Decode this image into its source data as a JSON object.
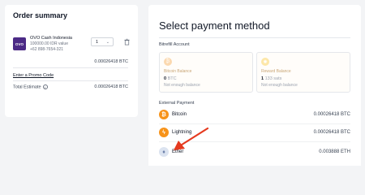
{
  "order": {
    "title": "Order summary",
    "item": {
      "logo_text": "OVO",
      "name": "OVO Cash Indonesia",
      "value": "100000.00 IDR value",
      "phone": "+62 898-7654-321",
      "quantity": "1",
      "price": "0.00026418 BTC"
    },
    "promo_label": "Enter a Promo Code",
    "total_label": "Total Estimate",
    "total_value": "0.00026418 BTC"
  },
  "payment": {
    "title": "Select payment method",
    "account_section": "Bitrefill Account",
    "balances": [
      {
        "name": "Bitcoin Balance",
        "amount_value": "0",
        "amount_unit": "BTC",
        "note": "Not enough balance",
        "icon": "bitcoin-icon"
      },
      {
        "name": "Reward Balance",
        "amount_value": "1",
        "amount_unit": "133 sats",
        "note": "Not enough balance",
        "icon": "reward-sun-icon"
      }
    ],
    "external_section": "External Payment",
    "methods": [
      {
        "name": "Bitcoin",
        "amount": "0.00026418 BTC",
        "icon": "bitcoin-icon",
        "color": "#f7931a"
      },
      {
        "name": "Lightning",
        "amount": "0.00026418 BTC",
        "icon": "lightning-icon",
        "color": "#f7931a"
      },
      {
        "name": "Ether",
        "amount": "0.003888 ETH",
        "icon": "ether-icon",
        "color": "#c9d4e8"
      }
    ]
  },
  "colors": {
    "background": "#f3f4f6",
    "ovo_purple": "#4c2a86",
    "bitcoin_orange": "#f7931a",
    "arrow_red": "#e53a1f"
  }
}
